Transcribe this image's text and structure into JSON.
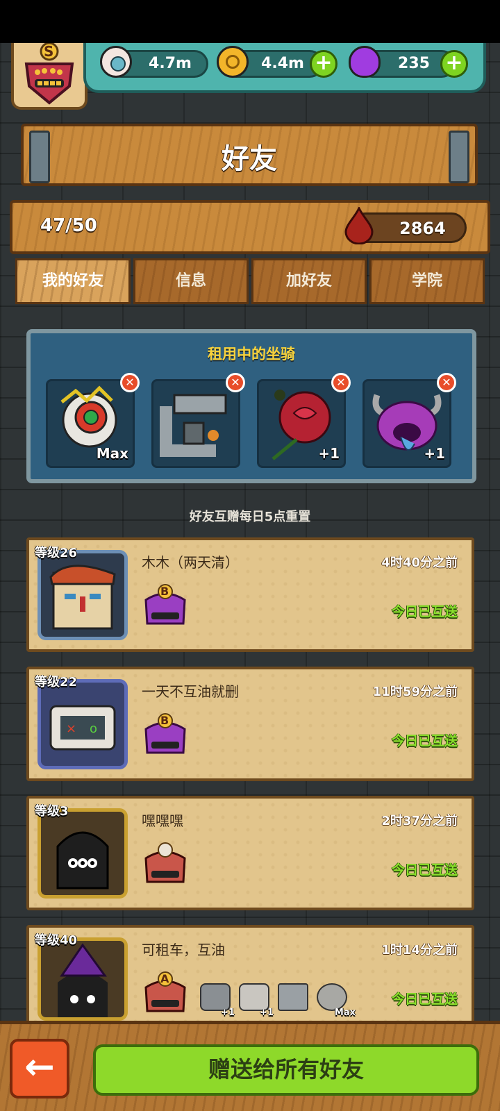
{
  "resources": {
    "eyes": "4.7m",
    "coins": "4.4m",
    "potions": "235",
    "rank": "S"
  },
  "title": "好友",
  "counter": {
    "friends": "47/50",
    "blood": "2864"
  },
  "tabs": [
    {
      "label": "我的好友",
      "active": true
    },
    {
      "label": "信息",
      "active": false
    },
    {
      "label": "加好友",
      "active": false
    },
    {
      "label": "学院",
      "active": false
    }
  ],
  "mounts": {
    "title": "租用中的坐骑",
    "items": [
      {
        "name": "lion-dance-mount",
        "tag": "Max"
      },
      {
        "name": "machine-mount",
        "tag": ""
      },
      {
        "name": "rose-mount",
        "tag": "+1"
      },
      {
        "name": "purple-demon-mount",
        "tag": "+1"
      }
    ]
  },
  "reset_note": "好友互赠每日5点重置",
  "friends": [
    {
      "level": "等级26",
      "name": "木木（两天清）",
      "time": "4时40分之前",
      "status": "今日已互送",
      "rank": "B"
    },
    {
      "level": "等级22",
      "name": "一天不互油就删",
      "time": "11时59分之前",
      "status": "今日已互送",
      "rank": "B"
    },
    {
      "level": "等级3",
      "name": "嘿嘿嘿",
      "time": "2时37分之前",
      "status": "今日已互送",
      "rank": ""
    },
    {
      "level": "等级40",
      "name": "可租车，互油",
      "time": "1时14分之前",
      "status": "今日已互送",
      "rank": "A",
      "mount_tags": [
        "+1",
        "+1",
        "",
        "Max"
      ]
    }
  ],
  "buttons": {
    "back": "←",
    "send_all": "赠送给所有好友"
  }
}
